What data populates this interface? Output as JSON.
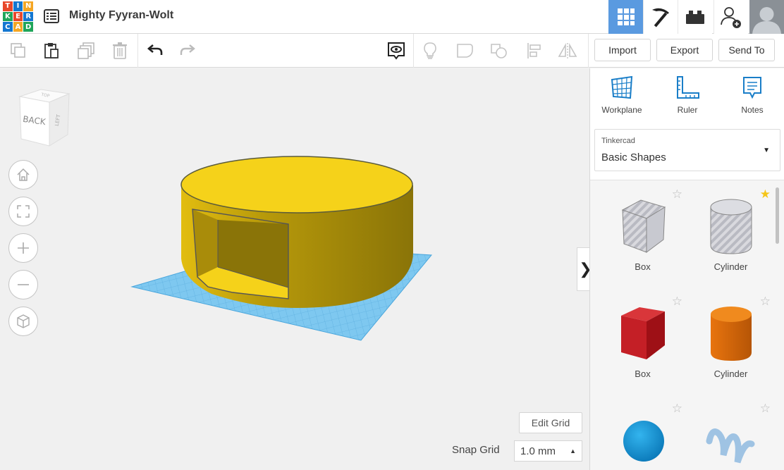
{
  "app": {
    "logo_letters": [
      "T",
      "I",
      "N",
      "K",
      "E",
      "R",
      "C",
      "A",
      "D"
    ],
    "design_title": "Mighty Fyyran-Wolt"
  },
  "header": {
    "buttons": [
      {
        "icon": "3d-view-grid-icon",
        "active": true
      },
      {
        "icon": "pickaxe-icon",
        "active": false
      },
      {
        "icon": "bricks-icon",
        "active": false
      },
      {
        "icon": "add-user-icon",
        "active": false
      }
    ]
  },
  "toolbar": {
    "left_icons": [
      "copy-icon",
      "paste-icon",
      "duplicate-icon",
      "delete-icon",
      "undo-icon",
      "redo-icon"
    ],
    "right_icons": [
      "show-all-icon",
      "lightbulb-icon",
      "group-icon",
      "ungroup-icon",
      "align-icon",
      "mirror-icon"
    ],
    "import_label": "Import",
    "export_label": "Export",
    "send_to_label": "Send To"
  },
  "canvas": {
    "viewcube_labels": {
      "front": "BACK",
      "side": "LEFT",
      "top": "TOP"
    },
    "nav_buttons": [
      "home-icon",
      "fit-view-icon",
      "zoom-in-icon",
      "zoom-out-icon",
      "orthographic-icon"
    ],
    "edit_grid_label": "Edit Grid",
    "snap_grid_label": "Snap Grid",
    "snap_grid_value": "1.0 mm",
    "object_color": "#f5d21a",
    "workplane_color": "#7ec8f0"
  },
  "panel": {
    "tools": [
      {
        "label": "Workplane",
        "icon": "workplane-icon"
      },
      {
        "label": "Ruler",
        "icon": "ruler-icon"
      },
      {
        "label": "Notes",
        "icon": "notes-icon"
      }
    ],
    "library_category": "Tinkercad",
    "library_name": "Basic Shapes",
    "shapes": [
      {
        "label": "Box",
        "kind": "hole-box",
        "favorite": false
      },
      {
        "label": "Cylinder",
        "kind": "hole-cylinder",
        "favorite": true
      },
      {
        "label": "Box",
        "kind": "red-box",
        "favorite": false
      },
      {
        "label": "Cylinder",
        "kind": "orange-cylinder",
        "favorite": false
      },
      {
        "label": "",
        "kind": "blue-sphere",
        "favorite": false
      },
      {
        "label": "",
        "kind": "scribble",
        "favorite": false
      }
    ],
    "collapse_glyph": "❯"
  }
}
